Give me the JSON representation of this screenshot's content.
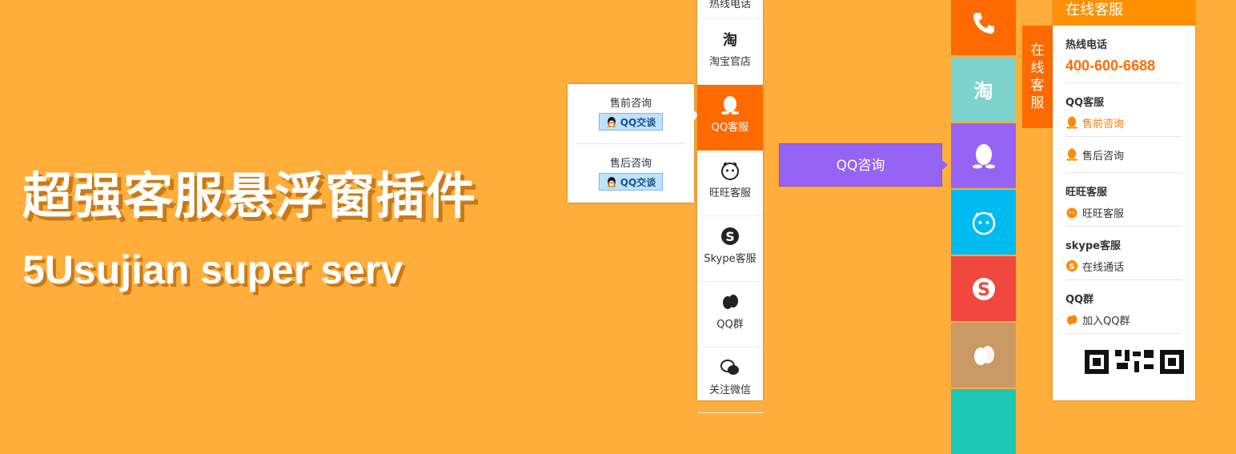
{
  "hero": {
    "title": "超强客服悬浮窗插件",
    "subtitle": "5Usujian super serv"
  },
  "sidebar1": {
    "top_partial_label": "热线电话",
    "items": [
      {
        "label": "淘宝官店",
        "icon": "taobao-icon"
      },
      {
        "label": "QQ客服",
        "icon": "qq-penguin-icon",
        "active": true
      },
      {
        "label": "旺旺客服",
        "icon": "wangwang-icon"
      },
      {
        "label": "Skype客服",
        "icon": "skype-icon"
      },
      {
        "label": "QQ群",
        "icon": "qq-group-icon"
      },
      {
        "label": "关注微信",
        "icon": "wechat-icon"
      }
    ],
    "qq_popup": {
      "rows": [
        {
          "label": "售前咨询",
          "button": "QQ交谈"
        },
        {
          "label": "售后咨询",
          "button": "QQ交谈"
        }
      ]
    }
  },
  "sidebar2": {
    "tooltip": "QQ咨询",
    "tiles": [
      {
        "icon": "phone-icon",
        "color": "#FF6A00",
        "text": ""
      },
      {
        "icon": "taobao-icon",
        "color": "#7ED3CC",
        "text": "淘"
      },
      {
        "icon": "qq-penguin-icon",
        "color": "#9564F5",
        "text": ""
      },
      {
        "icon": "wangwang-icon",
        "color": "#00BBF0",
        "text": ""
      },
      {
        "icon": "skype-icon",
        "color": "#F0483E",
        "text": ""
      },
      {
        "icon": "qq-group-icon",
        "color": "#C99A66",
        "text": ""
      },
      {
        "icon": "wechat-icon",
        "color": "#1CC7B6",
        "text": ""
      }
    ]
  },
  "panel3": {
    "tab_chars": [
      "在",
      "线",
      "客",
      "服"
    ],
    "header": "在线客服",
    "hotline_title": "热线电话",
    "hotline_number": "400-600-6688",
    "qq_title": "QQ客服",
    "qq_presale": "售前咨询",
    "qq_aftersale": "售后咨询",
    "ww_title": "旺旺客服",
    "ww_item": "旺旺客服",
    "skype_title": "skype客服",
    "skype_item": "在线通话",
    "qqgroup_title": "QQ群",
    "qqgroup_item": "加入QQ群"
  },
  "colors": {
    "background": "#FFAE3B",
    "accent_orange": "#FF6A00",
    "purple": "#9564F5"
  }
}
